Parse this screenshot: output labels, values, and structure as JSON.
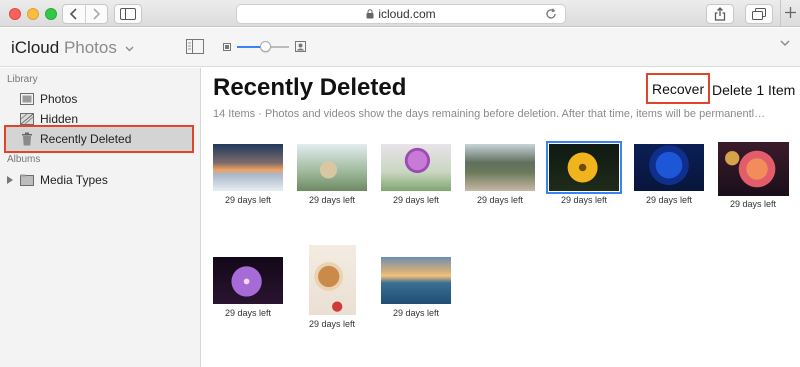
{
  "browser": {
    "url": "icloud.com"
  },
  "app": {
    "brand_primary": "iCloud",
    "brand_app": "Photos",
    "zoom_level": 0.55
  },
  "sidebar": {
    "library_title": "Library",
    "albums_title": "Albums",
    "items": [
      {
        "label": "Photos",
        "icon": "photos-icon"
      },
      {
        "label": "Hidden",
        "icon": "hidden-icon"
      },
      {
        "label": "Recently Deleted",
        "icon": "trash-icon",
        "active": true
      }
    ],
    "album_items": [
      {
        "label": "Media Types",
        "icon": "folder-icon"
      }
    ]
  },
  "main": {
    "title": "Recently Deleted",
    "recover_label": "Recover",
    "delete_label": "Delete 1 Item",
    "subtitle": "14 Items  ·  Photos and videos show the days remaining before deletion. After that time, items will be permanentl…",
    "photos": [
      {
        "caption": "29 days left",
        "subject": "mountain sunset",
        "selected": false
      },
      {
        "caption": "29 days left",
        "subject": "ostrich",
        "selected": false
      },
      {
        "caption": "29 days left",
        "subject": "purple flower",
        "selected": false
      },
      {
        "caption": "29 days left",
        "subject": "people in field",
        "selected": false
      },
      {
        "caption": "29 days left",
        "subject": "yellow flower",
        "selected": true
      },
      {
        "caption": "29 days left",
        "subject": "blue rose",
        "selected": false
      },
      {
        "caption": "29 days left",
        "subject": "orange roses",
        "selected": false
      },
      {
        "caption": "29 days left",
        "subject": "violet daisy",
        "selected": false
      },
      {
        "caption": "29 days left",
        "subject": "food bowl",
        "selected": false
      },
      {
        "caption": "29 days left",
        "subject": "ocean sunset",
        "selected": false
      }
    ]
  },
  "colors": {
    "highlight": "#e0442a",
    "selection": "#3a82f7"
  }
}
